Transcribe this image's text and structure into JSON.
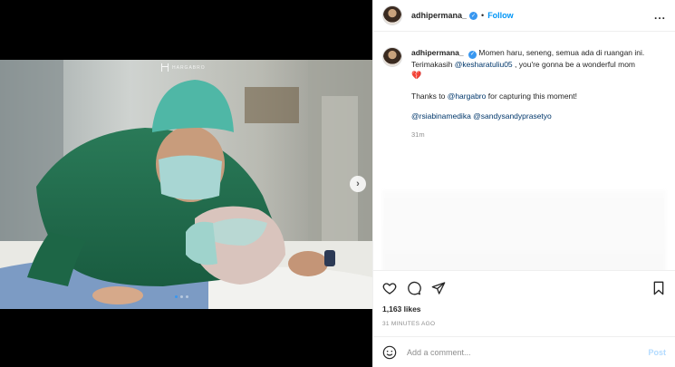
{
  "watermark": {
    "brand": "HARGABRO"
  },
  "carousel": {
    "slide_count": 3,
    "active_index": 0,
    "next_icon": "chevron-right"
  },
  "header": {
    "username": "adhipermana_",
    "separator": "•",
    "follow_label": "Follow",
    "more_icon": "..."
  },
  "caption": {
    "username": "adhipermana_",
    "line1": "Momen haru, seneng, semua ada di ruangan ini. Terimakasih",
    "mention1": "@kesharatuliu05",
    "line1_end": ", you're gonna be a wonderful mom",
    "heart": "💔",
    "thanks_pre": "Thanks to",
    "mention2": "@hargabro",
    "thanks_post": "for capturing this moment!",
    "mention3": "@rsiabinamedika",
    "mention4": "@sandysandyprasetyo",
    "time_ago": "31m"
  },
  "stats": {
    "likes": "1,163 likes",
    "posted": "31 MINUTES AGO"
  },
  "comment_box": {
    "placeholder": "Add a comment...",
    "post_label": "Post"
  },
  "colors": {
    "accent": "#0095f6",
    "scrubs": "#1f6b4b",
    "cap": "#4fb7a6",
    "mask": "#a8d6d3"
  }
}
